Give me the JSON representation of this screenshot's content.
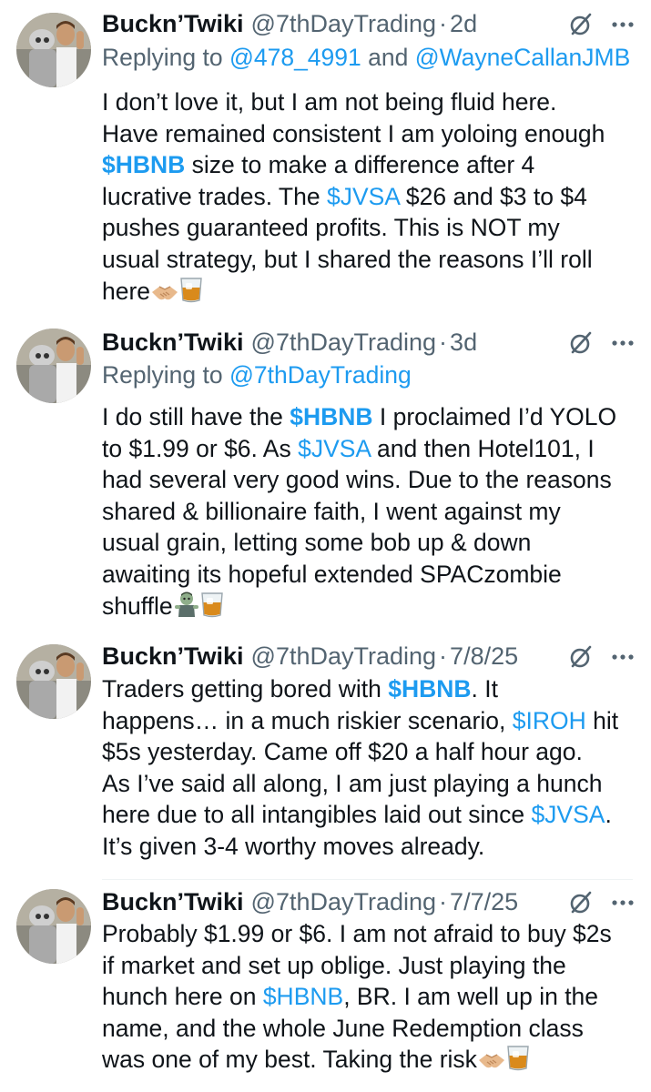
{
  "tweets": [
    {
      "display_name": "Buckn’Twiki",
      "handle": "@7thDayTrading",
      "dot": "·",
      "time": "2d",
      "reply": {
        "prefix": "Replying to ",
        "mention1": "@478_4991",
        "conj": " and ",
        "mention2": "@WayneCallanJMB"
      },
      "lines": [
        {
          "a": "I don’t love it, but I am not being fluid here."
        },
        {
          "a": "Have remained consistent I am yoloing enough"
        },
        {
          "tag": "$HBNB",
          "b": " size to make a difference after 4"
        },
        {
          "a": "lucrative trades. The ",
          "tag": "$JVSA",
          "b": " $26 and $3 to $4"
        },
        {
          "a": "pushes guaranteed profits. This is NOT my"
        },
        {
          "a": "usual strategy, but I shared the reasons I’ll roll"
        },
        {
          "a": "here"
        }
      ]
    },
    {
      "display_name": "Buckn’Twiki",
      "handle": "@7thDayTrading",
      "dot": "·",
      "time": "3d",
      "reply": {
        "prefix": "Replying to ",
        "mention1": "@7thDayTrading"
      },
      "lines": [
        {
          "a": "I do still have the ",
          "tag": "$HBNB",
          "b": " I proclaimed I’d YOLO"
        },
        {
          "a": "to $1.99 or $6. As ",
          "tag": "$JVSA",
          "b": " and then Hotel101, I"
        },
        {
          "a": "had several very good wins. Due to the reasons"
        },
        {
          "a": "shared & billionaire faith, I went against my"
        },
        {
          "a": "usual grain, letting some bob up & down"
        },
        {
          "a": "awaiting its hopeful extended SPACzombie"
        },
        {
          "a": "shuffle"
        }
      ]
    },
    {
      "display_name": "Buckn’Twiki",
      "handle": "@7thDayTrading",
      "dot": "·",
      "time": "7/8/25",
      "lines": [
        {
          "a": "Traders getting bored with ",
          "tag": "$HBNB",
          "b": ". It"
        },
        {
          "a": "happens… in a much riskier scenario, ",
          "tag": "$IROH",
          "b": " hit"
        },
        {
          "a": "$5s yesterday. Came off $20 a half hour ago."
        },
        {
          "a": "As I’ve said all along, I am just playing a hunch"
        },
        {
          "a": "here due to all intangibles laid out since ",
          "tag": "$JVSA",
          "b": "."
        },
        {
          "a": "It’s given 3-4 worthy moves already."
        }
      ]
    },
    {
      "display_name": "Buckn’Twiki",
      "handle": "@7thDayTrading",
      "dot": "·",
      "time": "7/7/25",
      "lines": [
        {
          "a": "Probably $1.99 or $6. I am not afraid to buy $2s"
        },
        {
          "a": "if market and set up oblige. Just playing the"
        },
        {
          "a": "hunch here on ",
          "tag": "$HBNB",
          "b": ", BR. I am well up in the"
        },
        {
          "a": "name, and the whole June Redemption class"
        },
        {
          "a": "was one of my best. Taking the risk"
        }
      ]
    }
  ],
  "icons": {
    "grok": "grok-slash-circle-icon",
    "more": "more-horizontal-icon",
    "handshake": "handshake-emoji",
    "whiskey": "tumbler-glass-emoji",
    "zombie": "zombie-emoji"
  },
  "colors": {
    "link": "#1d9bf0",
    "text": "#0f1419",
    "secondary": "#536471"
  }
}
